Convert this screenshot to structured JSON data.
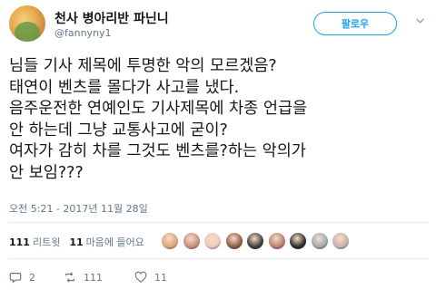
{
  "author": {
    "display_name": "천사 병아리반 파닌니",
    "handle": "@fannyny1"
  },
  "follow_button": "팔로우",
  "tweet": {
    "lines": [
      "님들 기사 제목에 투명한 악의 모르겠음?",
      "태연이 벤츠를 몰다가 사고를 냈다.",
      "음주운전한 연예인도 기사제목에 차종 언급을",
      "안 하는데 그냥 교통사고에 굳이?",
      "여자가 감히 차를 그것도 벤츠를?하는 악의가",
      "안 보임???"
    ],
    "timestamp": "오전 5:21 - 2017년 11월 28일"
  },
  "stats": {
    "retweets_count": "111",
    "retweets_label": "리트윗",
    "likes_count": "11",
    "likes_label": "마음에 들어요"
  },
  "likers": [
    {
      "icon": "liker-avatar",
      "color": "#d9a57a"
    },
    {
      "icon": "liker-avatar",
      "color": "#c98b7d"
    },
    {
      "icon": "liker-avatar",
      "color": "#f0c7c0"
    },
    {
      "icon": "liker-avatar",
      "color": "#8a5a44"
    },
    {
      "icon": "liker-avatar",
      "color": "#3b3b3b"
    },
    {
      "icon": "liker-avatar",
      "color": "#b87d6a"
    },
    {
      "icon": "liker-avatar",
      "color": "#2e2a2a"
    },
    {
      "icon": "liker-avatar",
      "color": "#9aa7b0"
    },
    {
      "icon": "liker-avatar",
      "color": "#c8b0a8"
    }
  ],
  "actions": {
    "reply_count": "2",
    "retweet_count": "111",
    "like_count": "11"
  },
  "colors": {
    "accent": "#1da1f2",
    "text": "#14171a",
    "muted": "#657786",
    "divider": "#e6ecf0"
  }
}
